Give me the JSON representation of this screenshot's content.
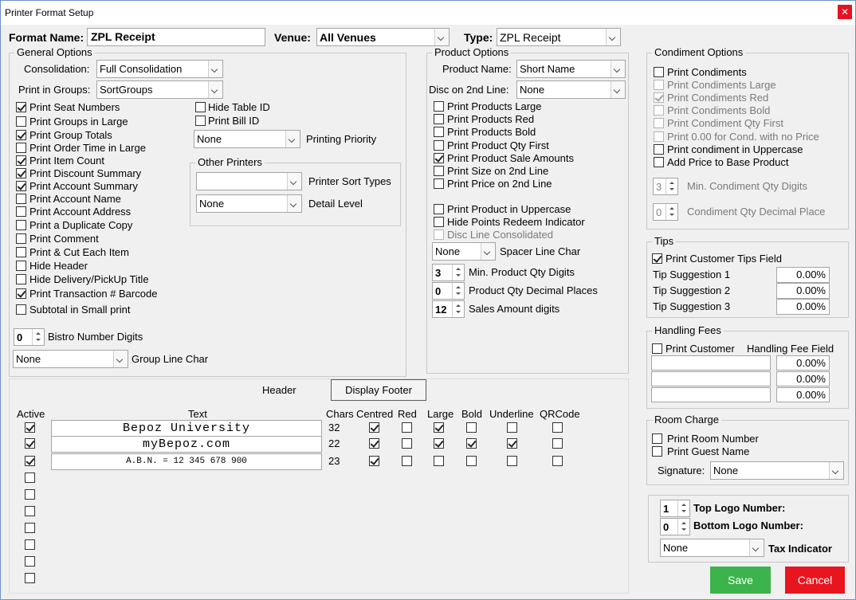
{
  "window": {
    "title": "Printer Format Setup"
  },
  "top": {
    "format_label": "Format Name:",
    "format_value": "ZPL Receipt",
    "venue_label": "Venue:",
    "venue_value": "All Venues",
    "type_label": "Type:",
    "type_value": "ZPL Receipt"
  },
  "general": {
    "title": "General Options",
    "consolidation_label": "Consolidation:",
    "consolidation_value": "Full Consolidation",
    "groups_label": "Print in Groups:",
    "groups_value": "SortGroups",
    "checks": [
      {
        "label": "Print Seat Numbers",
        "checked": true
      },
      {
        "label": "Print Groups in Large",
        "checked": false
      },
      {
        "label": "Print Group Totals",
        "checked": true
      },
      {
        "label": "Print Order Time in Large",
        "checked": false
      },
      {
        "label": "Print Item Count",
        "checked": true
      },
      {
        "label": "Print Discount Summary",
        "checked": true
      },
      {
        "label": "Print Account Summary",
        "checked": true
      },
      {
        "label": "Print Account Name",
        "checked": false
      },
      {
        "label": "Print Account Address",
        "checked": false
      },
      {
        "label": "Print a Duplicate Copy",
        "checked": false
      },
      {
        "label": "Print Comment",
        "checked": false
      },
      {
        "label": "Print & Cut Each Item",
        "checked": false
      },
      {
        "label": "Hide Header",
        "checked": false
      },
      {
        "label": "Hide Delivery/PickUp Title",
        "checked": false
      },
      {
        "label": "Print Transaction # Barcode",
        "checked": true
      },
      {
        "label": "Subtotal in Small print",
        "checked": false
      }
    ],
    "hide_table_id": "Hide Table ID",
    "print_bill_id": "Print Bill ID",
    "priority_value": "None",
    "priority_label": "Printing Priority",
    "other_printers_title": "Other Printers",
    "sort_types_value": "",
    "sort_types_label": "Printer Sort Types",
    "detail_value": "None",
    "detail_label": "Detail Level",
    "bistro_value": "0",
    "bistro_label": "Bistro Number Digits",
    "group_line_value": "None",
    "group_line_label": "Group Line Char"
  },
  "product": {
    "title": "Product Options",
    "name_label": "Product Name:",
    "name_value": "Short Name",
    "disc_label": "Disc on 2nd Line:",
    "disc_value": "None",
    "checks": [
      {
        "label": "Print Products Large",
        "checked": false
      },
      {
        "label": "Print Products Red",
        "checked": false
      },
      {
        "label": "Print Products Bold",
        "checked": false
      },
      {
        "label": "Print Product Qty First",
        "checked": false
      },
      {
        "label": "Print Product Sale Amounts",
        "checked": true
      },
      {
        "label": "Print Size on 2nd Line",
        "checked": false
      },
      {
        "label": "Print Price on 2nd Line",
        "checked": false
      }
    ],
    "checks2": [
      {
        "label": "Print Product in Uppercase",
        "checked": false
      },
      {
        "label": "Hide Points Redeem Indicator",
        "checked": false
      },
      {
        "label": "Disc Line Consolidated",
        "checked": false
      }
    ],
    "spacer_value": "None",
    "spacer_label": "Spacer Line Char",
    "min_qty_value": "3",
    "min_qty_label": "Min. Product Qty Digits",
    "qty_dec_value": "0",
    "qty_dec_label": "Product Qty Decimal Places",
    "sales_value": "12",
    "sales_label": "Sales Amount digits"
  },
  "condiment": {
    "title": "Condiment Options",
    "checks": [
      {
        "label": "Print Condiments",
        "checked": false,
        "disabled": false
      },
      {
        "label": "Print Condiments Large",
        "checked": false,
        "disabled": true
      },
      {
        "label": "Print Condiments Red",
        "checked": true,
        "disabled": true
      },
      {
        "label": "Print Condiments Bold",
        "checked": false,
        "disabled": true
      },
      {
        "label": "Print Condiment Qty First",
        "checked": false,
        "disabled": true
      },
      {
        "label": "Print 0.00 for Cond. with no Price",
        "checked": false,
        "disabled": true
      },
      {
        "label": "Print condiment in Uppercase",
        "checked": false,
        "disabled": false
      },
      {
        "label": "Add Price to Base Product",
        "checked": false,
        "disabled": false
      }
    ],
    "min_value": "3",
    "min_label": "Min. Condiment Qty Digits",
    "dec_value": "0",
    "dec_label": "Condiment Qty Decimal Place"
  },
  "tips": {
    "title": "Tips",
    "field_label": "Print Customer Tips Field",
    "rows": [
      {
        "label": "Tip Suggestion 1",
        "value": "0.00%"
      },
      {
        "label": "Tip Suggestion 2",
        "value": "0.00%"
      },
      {
        "label": "Tip Suggestion 3",
        "value": "0.00%"
      }
    ]
  },
  "handling": {
    "title": "Handling Fees",
    "print_label": "Print Customer",
    "field_label": "Handling Fee Field",
    "values": [
      "0.00%",
      "0.00%",
      "0.00%"
    ]
  },
  "room": {
    "title": "Room Charge",
    "room_number": "Print Room Number",
    "guest_name": "Print Guest Name",
    "signature_label": "Signature:",
    "signature_value": "None"
  },
  "logo": {
    "top_value": "1",
    "top_label": "Top Logo Number:",
    "bottom_value": "0",
    "bottom_label": "Bottom Logo Number:",
    "tax_value": "None",
    "tax_label": "Tax Indicator"
  },
  "header_section": {
    "header_tab": "Header",
    "footer_button": "Display Footer",
    "columns": {
      "active": "Active",
      "text": "Text",
      "chars": "Chars",
      "centred": "Centred",
      "red": "Red",
      "large": "Large",
      "bold": "Bold",
      "underline": "Underline",
      "qrcode": "QRCode"
    },
    "rows": [
      {
        "active": true,
        "text": "Bepoz University",
        "chars": "32",
        "centred": true,
        "red": false,
        "large": true,
        "bold": false,
        "underline": false,
        "qrcode": false
      },
      {
        "active": true,
        "text": "myBepoz.com",
        "chars": "22",
        "centred": true,
        "red": false,
        "large": true,
        "bold": true,
        "underline": true,
        "qrcode": false
      },
      {
        "active": true,
        "text": "A.B.N. = 12 345 678 900",
        "chars": "23",
        "centred": true,
        "red": false,
        "large": false,
        "bold": false,
        "underline": false,
        "qrcode": false
      }
    ],
    "empty_rows": 7
  },
  "actions": {
    "save": "Save",
    "cancel": "Cancel"
  },
  "colors": {
    "save": "#3cb44b",
    "cancel": "#e8151f",
    "border": "#6d8fd1"
  }
}
